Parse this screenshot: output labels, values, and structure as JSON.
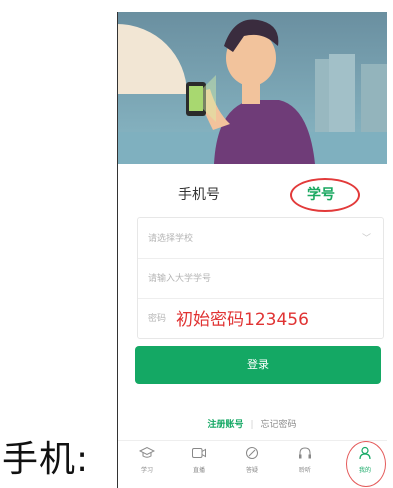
{
  "caption": "手机:",
  "login_tabs": {
    "phone_label": "手机号",
    "student_label": "学号"
  },
  "form": {
    "school_placeholder": "请选择学校",
    "student_id_placeholder": "请输入大学学号",
    "password_placeholder": "密码",
    "password_hint": "初始密码123456"
  },
  "login_button": "登录",
  "links": {
    "register": "注册账号",
    "forgot": "忘记密码"
  },
  "tabbar": [
    {
      "label": "学习",
      "icon": "graduation-cap-icon"
    },
    {
      "label": "直播",
      "icon": "live-video-icon"
    },
    {
      "label": "答疑",
      "icon": "pencil-icon"
    },
    {
      "label": "聆听",
      "icon": "headphones-icon"
    },
    {
      "label": "我的",
      "icon": "user-icon"
    }
  ],
  "colors": {
    "accent": "#14a864",
    "annotation": "#e23a3a"
  }
}
